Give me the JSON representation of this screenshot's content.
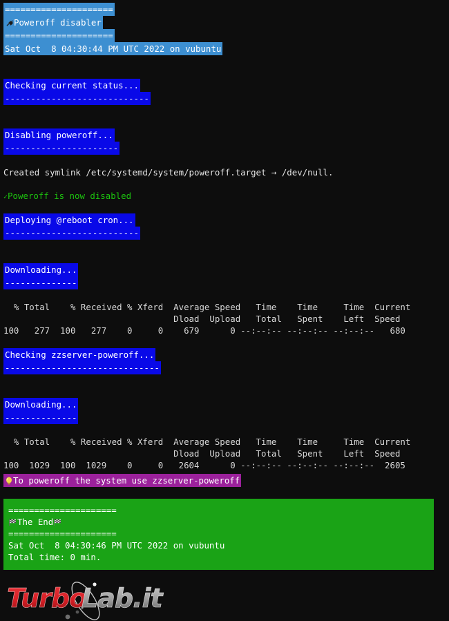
{
  "terminal": {
    "background": "#0d0d0d",
    "header": {
      "icon": "power-plug-icon",
      "rule_top": "=====================",
      "title": "Poweroff disabler",
      "rule_bottom": "=====================",
      "timestamp": "Sat Oct  8 04:30:44 PM UTC 2022 on vubuntu",
      "bg_color": "#3d8fd1"
    },
    "sections": [
      {
        "title": "Checking current status...",
        "rule": "----------------------------",
        "bg_color": "#0909e8"
      },
      {
        "title": "Disabling poweroff...",
        "rule": "----------------------",
        "bg_color": "#0909e8"
      },
      {
        "title": "Deploying @reboot cron...",
        "rule": "--------------------------",
        "bg_color": "#0909e8"
      },
      {
        "title": "Downloading...",
        "rule": "--------------",
        "bg_color": "#0909e8"
      },
      {
        "title": "Checking zzserver-poweroff...",
        "rule": "------------------------------",
        "bg_color": "#0909e8"
      },
      {
        "title": "Downloading...",
        "rule": "--------------",
        "bg_color": "#0909e8"
      }
    ],
    "symlink_message": "Created symlink /etc/systemd/system/poweroff.target → /dev/null.",
    "status_line": {
      "check": "✓",
      "text": "Poweroff is now disabled",
      "color": "#1cc40e"
    },
    "curl_tables": [
      {
        "header_row_1": "  % Total    % Received % Xferd  Average Speed   Time    Time     Time  Current",
        "header_row_2": "                                 Dload  Upload   Total   Spent    Left  Speed",
        "data_row": "100   277  100   277    0     0    679      0 --:--:-- --:--:-- --:--:--   680",
        "values": {
          "pct_total": "100",
          "total": "277",
          "pct_received": "100",
          "received": "277",
          "pct_xferd": "0",
          "xferd": "0",
          "avg_dload": "679",
          "avg_upload": "0",
          "time_total": "--:--:--",
          "time_spent": "--:--:--",
          "time_left": "--:--:--",
          "current_speed": "680"
        }
      },
      {
        "header_row_1": "  % Total    % Received % Xferd  Average Speed   Time    Time     Time  Current",
        "header_row_2": "                                 Dload  Upload   Total   Spent    Left  Speed",
        "data_row": "100  1029  100  1029    0     0   2604      0 --:--:-- --:--:-- --:--:--  2605",
        "values": {
          "pct_total": "100",
          "total": "1029",
          "pct_received": "100",
          "received": "1029",
          "pct_xferd": "0",
          "xferd": "0",
          "avg_dload": "2604",
          "avg_upload": "0",
          "time_total": "--:--:--",
          "time_spent": "--:--:--",
          "time_left": "--:--:--",
          "current_speed": "2605"
        }
      }
    ],
    "tip": {
      "icon": "light-bulb-icon",
      "text": "To poweroff the system use zzserver-poweroff",
      "bg_color": "#9b219b"
    },
    "footer": {
      "rule_top": "=====================",
      "icon_left": "chequered-flag-icon",
      "title": "The End",
      "icon_right": "chequered-flag-icon",
      "rule_bottom": "=====================",
      "timestamp": "Sat Oct  8 04:30:46 PM UTC 2022 on vubuntu",
      "total_time": "Total time: 0 min.",
      "bg_color": "#1aa316"
    }
  },
  "logo": {
    "text_primary": "Turbo",
    "text_secondary": "Lab.it",
    "primary_color": "#d81f26",
    "secondary_color": "#9c9c9c"
  }
}
